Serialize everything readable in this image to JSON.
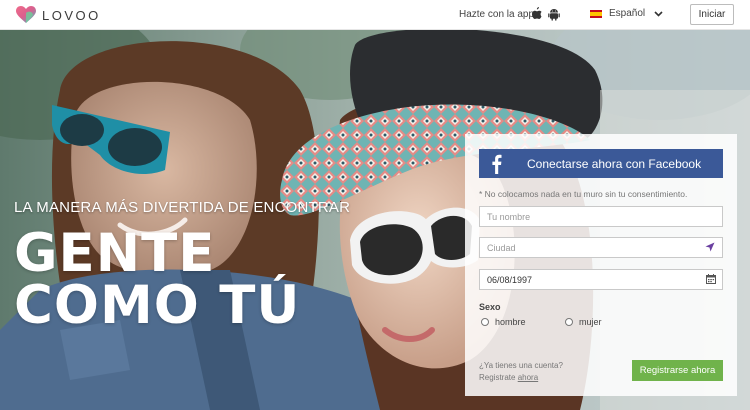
{
  "header": {
    "logo_text": "LOVOO",
    "app_text": "Hazte con la app",
    "language": "Español",
    "login_label": "Iniciar"
  },
  "hero": {
    "tagline": "LA MANERA MÁS DIVERTIDA DE ENCONTRAR",
    "headline_line1": "GENTE",
    "headline_line2": "COMO TÚ"
  },
  "form": {
    "facebook_label": "Conectarse ahora con Facebook",
    "note": "* No colocamos nada en tu muro sin tu consentimiento.",
    "name_placeholder": "Tu nombre",
    "city_placeholder": "Ciudad",
    "birthdate_value": "06/08/1997",
    "sex_label": "Sexo",
    "male_label": "hombre",
    "female_label": "mujer",
    "account_question": "¿Ya tienes una cuenta?",
    "account_prefix": "Registrate",
    "account_link": "ahora",
    "register_label": "Registrarse ahora"
  },
  "colors": {
    "facebook": "#3b5998",
    "register": "#70b34b",
    "logo_heart": "#e84a6f"
  },
  "icons": [
    "heart-logo-icon",
    "apple-icon",
    "android-icon",
    "spain-flag-icon",
    "chevron-down-icon",
    "facebook-icon",
    "location-arrow-icon",
    "calendar-icon"
  ]
}
